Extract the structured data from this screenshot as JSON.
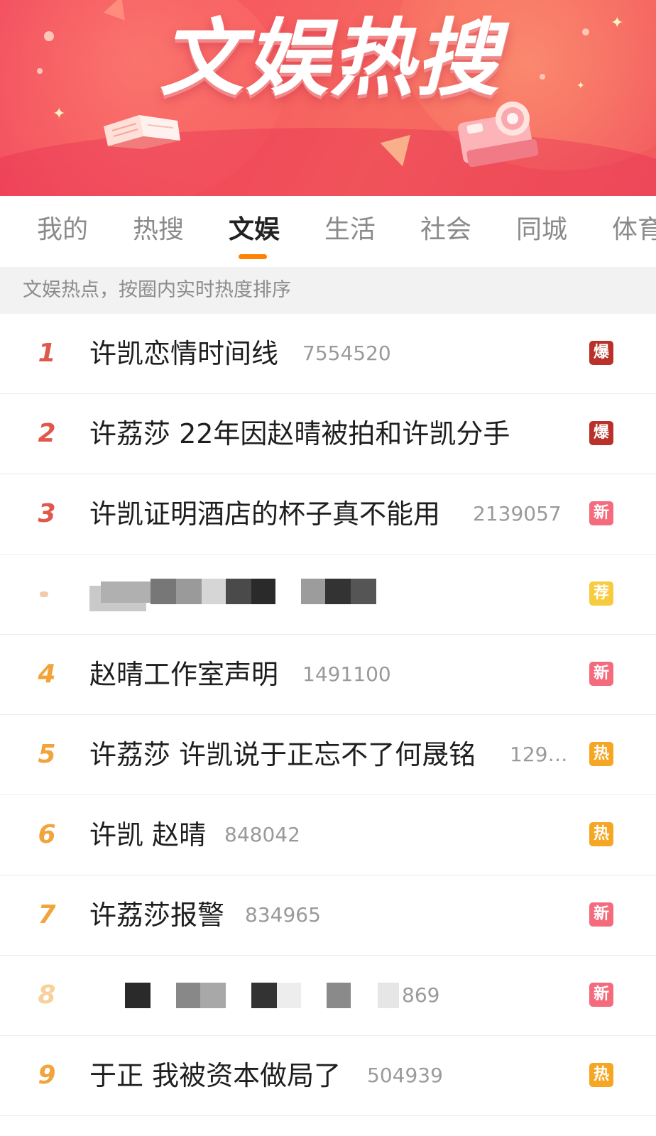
{
  "banner": {
    "title": "文娱热搜"
  },
  "tabs": [
    "我的",
    "热搜",
    "文娱",
    "生活",
    "社会",
    "同城",
    "体育"
  ],
  "active_tab": "文娱",
  "subheader": "文娱热点，按圈内实时热度排序",
  "items": [
    {
      "rank": "1",
      "title": "许凯恋情时间线",
      "count": "7554520",
      "badge": "爆"
    },
    {
      "rank": "2",
      "title": "许荔莎 22年因赵晴被拍和许凯分手",
      "count": "",
      "badge": "爆"
    },
    {
      "rank": "3",
      "title": "许凯证明酒店的杯子真不能用",
      "count": "2139057",
      "badge": "新"
    },
    {
      "rank": "",
      "title": "",
      "count": "",
      "badge": "荐"
    },
    {
      "rank": "4",
      "title": "赵晴工作室声明",
      "count": "1491100",
      "badge": "新"
    },
    {
      "rank": "5",
      "title": "许荔莎 许凯说于正忘不了何晟铭",
      "count": "129…",
      "badge": "热"
    },
    {
      "rank": "6",
      "title": "许凯 赵晴",
      "count": "848042",
      "badge": "热"
    },
    {
      "rank": "7",
      "title": "许荔莎报警",
      "count": "834965",
      "badge": "新"
    },
    {
      "rank": "8",
      "title": "",
      "count": "869",
      "badge": "新"
    },
    {
      "rank": "9",
      "title": "于正 我被资本做局了",
      "count": "504939",
      "badge": "热"
    }
  ],
  "colors": {
    "accent": "#ff8200",
    "rank_top": "#e0584c",
    "rank_other": "#f2a33a",
    "badge_bao": "#b9312a",
    "badge_xin": "#f46b7e",
    "badge_re": "#f5a623",
    "badge_jian": "#f7cb3d"
  }
}
